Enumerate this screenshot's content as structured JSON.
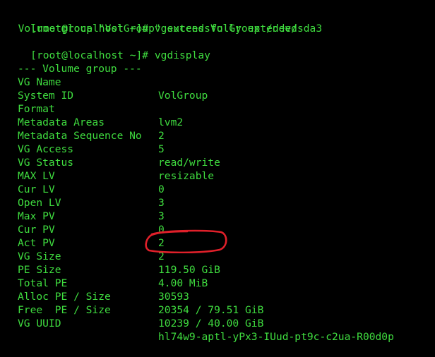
{
  "terminal": {
    "lines": {
      "cmd1": "[root@localhost ~]# vgextend VolGroup /dev/sda3",
      "msg1": "  Volume group \"VolGroup\" successfully extended",
      "cmd2": "[root@localhost ~]# vgdisplay",
      "header": "--- Volume group ---"
    },
    "rows": [
      {
        "key": "VG Name",
        "value": "VolGroup"
      },
      {
        "key": "System ID",
        "value": ""
      },
      {
        "key": "Format",
        "value": "lvm2"
      },
      {
        "key": "Metadata Areas",
        "value": "2"
      },
      {
        "key": "Metadata Sequence No",
        "value": "5"
      },
      {
        "key": "VG Access",
        "value": "read/write"
      },
      {
        "key": "VG Status",
        "value": "resizable"
      },
      {
        "key": "MAX LV",
        "value": "0"
      },
      {
        "key": "Cur LV",
        "value": "3"
      },
      {
        "key": "Open LV",
        "value": "3"
      },
      {
        "key": "Max PV",
        "value": "0"
      },
      {
        "key": "Cur PV",
        "value": "2"
      },
      {
        "key": "Act PV",
        "value": "2"
      },
      {
        "key": "VG Size",
        "value": "119.50 GiB"
      },
      {
        "key": "PE Size",
        "value": "4.00 MiB"
      },
      {
        "key": "Total PE",
        "value": "30593"
      },
      {
        "key": "Alloc PE / Size",
        "value": "20354 / 79.51 GiB"
      },
      {
        "key": "Free  PE / Size",
        "value": "10239 / 40.00 GiB"
      },
      {
        "key": "VG UUID",
        "value": "hl74w9-aptl-yPx3-IUud-pt9c-c2ua-R00d0p"
      }
    ]
  },
  "colors": {
    "background": "#000000",
    "text": "#3fdc3f",
    "annotation": "#e0202a"
  }
}
